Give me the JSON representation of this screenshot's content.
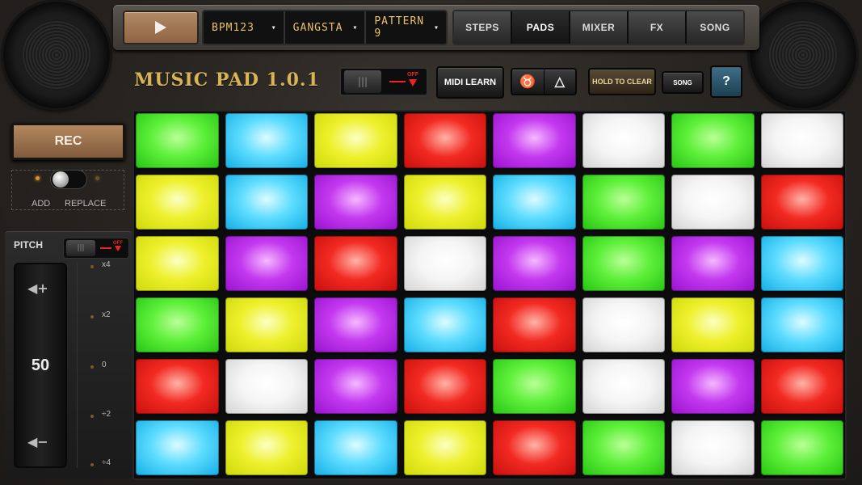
{
  "header": {
    "selects": [
      {
        "label": "BPM123",
        "arrow": "▾"
      },
      {
        "label": "GANGSTA",
        "arrow": "▾"
      },
      {
        "label": "PATTERN 9",
        "arrow": "▾"
      }
    ],
    "nav_tabs": [
      "STEPS",
      "PADS",
      "MIXER",
      "FX",
      "SONG"
    ],
    "active_tab": "PADS"
  },
  "toolbar": {
    "app_title": "MUSIC PAD 1.0.1",
    "toggle_off_label": "OFF",
    "midi_learn": "MIDI LEARN",
    "hold_to_clear": "HOLD TO CLEAR",
    "song": "SONG",
    "help": "?"
  },
  "record": {
    "rec_label": "REC",
    "mode_add": "ADD",
    "mode_replace": "REPLACE"
  },
  "pitch": {
    "title": "PITCH",
    "toggle_off_label": "OFF",
    "value": "50",
    "scale": [
      "x4",
      "x2",
      "0",
      "÷2",
      "÷4"
    ]
  },
  "pads": {
    "rows": [
      [
        "green",
        "cyan",
        "yellow",
        "red",
        "purple",
        "white",
        "green",
        "white"
      ],
      [
        "yellow",
        "cyan",
        "purple",
        "yellow",
        "cyan",
        "green",
        "white",
        "red"
      ],
      [
        "yellow",
        "purple",
        "red",
        "white",
        "purple",
        "green",
        "purple",
        "cyan"
      ],
      [
        "green",
        "yellow",
        "purple",
        "cyan",
        "red",
        "white",
        "yellow",
        "cyan"
      ],
      [
        "red",
        "white",
        "purple",
        "red",
        "green",
        "white",
        "purple",
        "red"
      ],
      [
        "cyan",
        "yellow",
        "cyan",
        "yellow",
        "red",
        "green",
        "white",
        "green"
      ]
    ]
  },
  "colors": {
    "accent_gold": "#d8b457",
    "rec_brown": "#b5895f",
    "led_orange": "#d9912a",
    "off_red": "#e22222"
  }
}
